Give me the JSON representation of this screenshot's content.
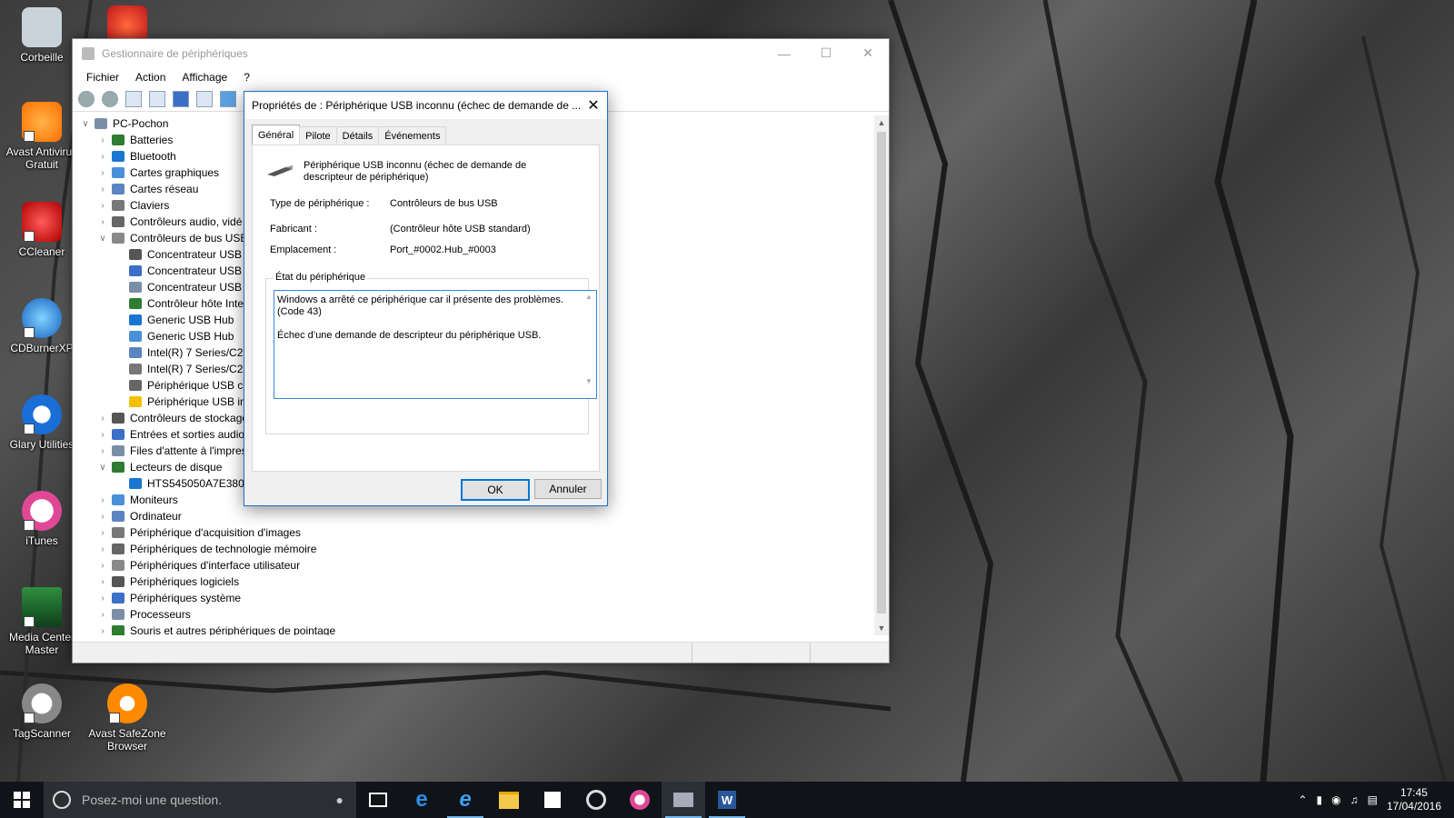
{
  "desktop": {
    "icons": [
      {
        "label": "Corbeille",
        "icon": "recycle-bin-icon"
      },
      {
        "label": "Avast Antivirus Gratuit",
        "icon": "avast-icon"
      },
      {
        "label": "CCleaner",
        "icon": "ccleaner-icon"
      },
      {
        "label": "CDBurnerXP",
        "icon": "cdburner-icon"
      },
      {
        "label": "Glary Utilities",
        "icon": "glary-icon"
      },
      {
        "label": "iTunes",
        "icon": "itunes-icon"
      },
      {
        "label": "Media Center Master",
        "icon": "media-center-icon"
      },
      {
        "label": "TagScanner",
        "icon": "tagscanner-icon"
      },
      {
        "label": "Avast SafeZone Browser",
        "icon": "safezone-icon"
      }
    ]
  },
  "device_manager": {
    "title": "Gestionnaire de périphériques",
    "menu": [
      "Fichier",
      "Action",
      "Affichage",
      "?"
    ],
    "tree": [
      {
        "label": "PC-Pochon",
        "level": 0,
        "expanded": true
      },
      {
        "label": "Batteries",
        "level": 1
      },
      {
        "label": "Bluetooth",
        "level": 1
      },
      {
        "label": "Cartes graphiques",
        "level": 1
      },
      {
        "label": "Cartes réseau",
        "level": 1
      },
      {
        "label": "Claviers",
        "level": 1
      },
      {
        "label": "Contrôleurs audio, vidé",
        "level": 1
      },
      {
        "label": "Contrôleurs de bus USB",
        "level": 1,
        "expanded": true
      },
      {
        "label": "Concentrateur USB r",
        "level": 2
      },
      {
        "label": "Concentrateur USB r",
        "level": 2
      },
      {
        "label": "Concentrateur USB r",
        "level": 2
      },
      {
        "label": "Contrôleur hôte Inte",
        "level": 2
      },
      {
        "label": "Generic USB Hub",
        "level": 2
      },
      {
        "label": "Generic USB Hub",
        "level": 2
      },
      {
        "label": "Intel(R) 7 Series/C21",
        "level": 2
      },
      {
        "label": "Intel(R) 7 Series/C21",
        "level": 2
      },
      {
        "label": "Périphérique USB co",
        "level": 2
      },
      {
        "label": "Périphérique USB in",
        "level": 2,
        "warning": true
      },
      {
        "label": "Contrôleurs de stockage",
        "level": 1
      },
      {
        "label": "Entrées et sorties audio",
        "level": 1
      },
      {
        "label": "Files d'attente à l'impres",
        "level": 1
      },
      {
        "label": "Lecteurs de disque",
        "level": 1,
        "expanded": true
      },
      {
        "label": "HTS545050A7E380",
        "level": 2
      },
      {
        "label": "Moniteurs",
        "level": 1
      },
      {
        "label": "Ordinateur",
        "level": 1
      },
      {
        "label": "Périphérique d'acquisition d'images",
        "level": 1
      },
      {
        "label": "Périphériques de technologie mémoire",
        "level": 1
      },
      {
        "label": "Périphériques d'interface utilisateur",
        "level": 1
      },
      {
        "label": "Périphériques logiciels",
        "level": 1
      },
      {
        "label": "Périphériques système",
        "level": 1
      },
      {
        "label": "Processeurs",
        "level": 1
      },
      {
        "label": "Souris et autres périphériques de pointage",
        "level": 1
      }
    ]
  },
  "dialog": {
    "title": "Propriétés de : Périphérique USB inconnu (échec de demande de ...",
    "tabs": [
      "Général",
      "Pilote",
      "Détails",
      "Événements"
    ],
    "device_name": "Périphérique USB inconnu (échec de demande de descripteur de périphérique)",
    "type_label": "Type de périphérique :",
    "type_value": "Contrôleurs de bus USB",
    "maker_label": "Fabricant :",
    "maker_value": "(Contrôleur hôte USB standard)",
    "location_label": "Emplacement :",
    "location_value": "Port_#0002.Hub_#0003",
    "state_label": "État du périphérique",
    "state_line1": "Windows a arrêté ce périphérique car il présente des problèmes. (Code 43)",
    "state_line2": "Échec d’une demande de descripteur du périphérique USB.",
    "ok_label": "OK",
    "cancel_label": "Annuler"
  },
  "taskbar": {
    "search_placeholder": "Posez-moi une question.",
    "time": "17:45",
    "date": "17/04/2016"
  }
}
